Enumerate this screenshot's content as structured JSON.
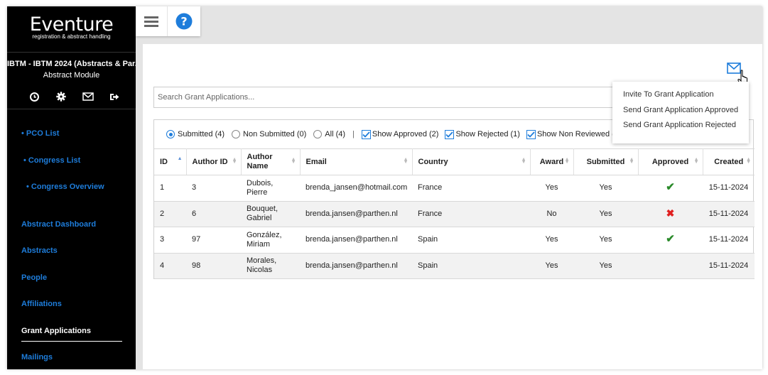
{
  "app": {
    "logo_name": "Eventure",
    "logo_tagline": "registration & abstract handling",
    "event_title": "IBTM - IBTM 2024 (Abstracts & Par...",
    "module": "Abstract Module"
  },
  "sidebar": {
    "icons": [
      "clock-icon",
      "gear-icon",
      "envelope-icon",
      "sign-out-icon"
    ],
    "items": [
      {
        "label": "• PCO List"
      },
      {
        "label": "• Congress List"
      },
      {
        "label": "• Congress Overview"
      },
      {
        "label": "Abstract Dashboard"
      },
      {
        "label": "Abstracts"
      },
      {
        "label": "People"
      },
      {
        "label": "Affiliations"
      },
      {
        "label": "Grant Applications",
        "active": true
      },
      {
        "label": "Mailings"
      }
    ]
  },
  "search": {
    "placeholder": "Search Grant Applications..."
  },
  "mail_menu": {
    "items": [
      {
        "label": "Invite To Grant Application"
      },
      {
        "label": "Send Grant Application Approved"
      },
      {
        "label": "Send Grant Application Rejected"
      }
    ]
  },
  "filters": {
    "radios": [
      {
        "label": "Submitted (4)",
        "selected": true
      },
      {
        "label": "Non Submitted (0)",
        "selected": false
      },
      {
        "label": "All (4)",
        "selected": false
      }
    ],
    "separator": "|",
    "checks": [
      {
        "label": "Show Approved (2)",
        "checked": true
      },
      {
        "label": "Show Rejected (1)",
        "checked": true
      },
      {
        "label": "Show Non Reviewed (1)",
        "checked": true
      }
    ]
  },
  "table": {
    "columns": [
      "ID",
      "Author ID",
      "Author Name",
      "Email",
      "Country",
      "Award",
      "Submitted",
      "Approved",
      "Created"
    ],
    "rows": [
      {
        "id": "1",
        "author_id": "3",
        "name_last": "Dubois,",
        "name_first": "Pierre",
        "email": "brenda_jansen@hotmail.com",
        "country": "France",
        "award": "Yes",
        "submitted": "Yes",
        "approved": "check",
        "created": "15-11-2024"
      },
      {
        "id": "2",
        "author_id": "6",
        "name_last": "Bouquet,",
        "name_first": "Gabriel",
        "email": "brenda.jansen@parthen.nl",
        "country": "France",
        "award": "No",
        "submitted": "Yes",
        "approved": "cross",
        "created": "15-11-2024"
      },
      {
        "id": "3",
        "author_id": "97",
        "name_last": "González,",
        "name_first": "Miriam",
        "email": "brenda.jansen@parthen.nl",
        "country": "Spain",
        "award": "Yes",
        "submitted": "Yes",
        "approved": "check",
        "created": "15-11-2024"
      },
      {
        "id": "4",
        "author_id": "98",
        "name_last": "Morales,",
        "name_first": "Nicolas",
        "email": "brenda.jansen@parthen.nl",
        "country": "Spain",
        "award": "Yes",
        "submitted": "Yes",
        "approved": "",
        "created": "15-11-2024"
      }
    ]
  },
  "colors": {
    "accent": "#1e7ddb",
    "approved": "#2a8a2a",
    "rejected": "#e02020",
    "sidebar_bg": "#000000"
  }
}
